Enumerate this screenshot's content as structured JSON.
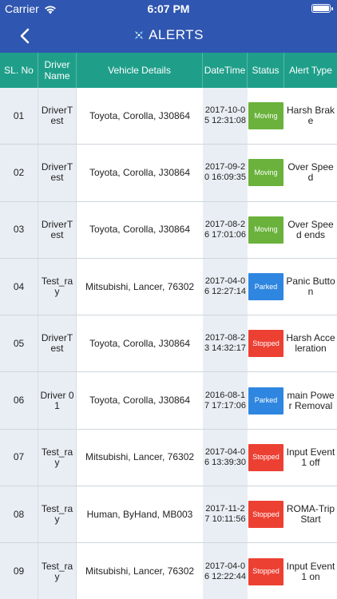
{
  "status_bar": {
    "carrier": "Carrier",
    "time": "6:07 PM"
  },
  "header": {
    "title": "ALERTS"
  },
  "colors": {
    "nav_bg": "#2f56b0",
    "table_header_bg": "#1f9f8a",
    "moving": "#6ab23c",
    "parked": "#2f86e0",
    "stopped": "#ec4033"
  },
  "columns": [
    "SL. No",
    "Driver Name",
    "Vehicle Details",
    "DateTime",
    "Status",
    "Alert Type"
  ],
  "rows": [
    {
      "sl": "01",
      "driver": "DriverTest",
      "vehicle": "Toyota, Corolla, J30864",
      "datetime": "2017-10-05 12:31:08",
      "status": "Moving",
      "status_kind": "moving",
      "alert": "Harsh Brake"
    },
    {
      "sl": "02",
      "driver": "DriverTest",
      "vehicle": "Toyota, Corolla, J30864",
      "datetime": "2017-09-20 16:09:35",
      "status": "Moving",
      "status_kind": "moving",
      "alert": "Over Speed"
    },
    {
      "sl": "03",
      "driver": "DriverTest",
      "vehicle": "Toyota, Corolla, J30864",
      "datetime": "2017-08-26 17:01:06",
      "status": "Moving",
      "status_kind": "moving",
      "alert": "Over Speed ends"
    },
    {
      "sl": "04",
      "driver": "Test_ray",
      "vehicle": "Mitsubishi, Lancer, 76302",
      "datetime": "2017-04-06 12:27:14",
      "status": "Parked",
      "status_kind": "parked",
      "alert": "Panic Button"
    },
    {
      "sl": "05",
      "driver": "DriverTest",
      "vehicle": "Toyota, Corolla, J30864",
      "datetime": "2017-08-23 14:32:17",
      "status": "Stopped",
      "status_kind": "stopped",
      "alert": "Harsh Acceleration"
    },
    {
      "sl": "06",
      "driver": "Driver 01",
      "vehicle": "Toyota, Corolla, J30864",
      "datetime": "2016-08-17 17:17:06",
      "status": "Parked",
      "status_kind": "parked",
      "alert": "main Power Removal"
    },
    {
      "sl": "07",
      "driver": "Test_ray",
      "vehicle": "Mitsubishi, Lancer, 76302",
      "datetime": "2017-04-06 13:39:30",
      "status": "Stopped",
      "status_kind": "stopped",
      "alert": "Input Event 1 off"
    },
    {
      "sl": "08",
      "driver": "Test_ray",
      "vehicle": "Human, ByHand, MB003",
      "datetime": "2017-11-27 10:11:56",
      "status": "Stopped",
      "status_kind": "stopped",
      "alert": "ROMA-Trip Start"
    },
    {
      "sl": "09",
      "driver": "Test_ray",
      "vehicle": "Mitsubishi, Lancer, 76302",
      "datetime": "2017-04-06 12:22:44",
      "status": "Stopped",
      "status_kind": "stopped",
      "alert": "Input Event 1 on"
    }
  ]
}
